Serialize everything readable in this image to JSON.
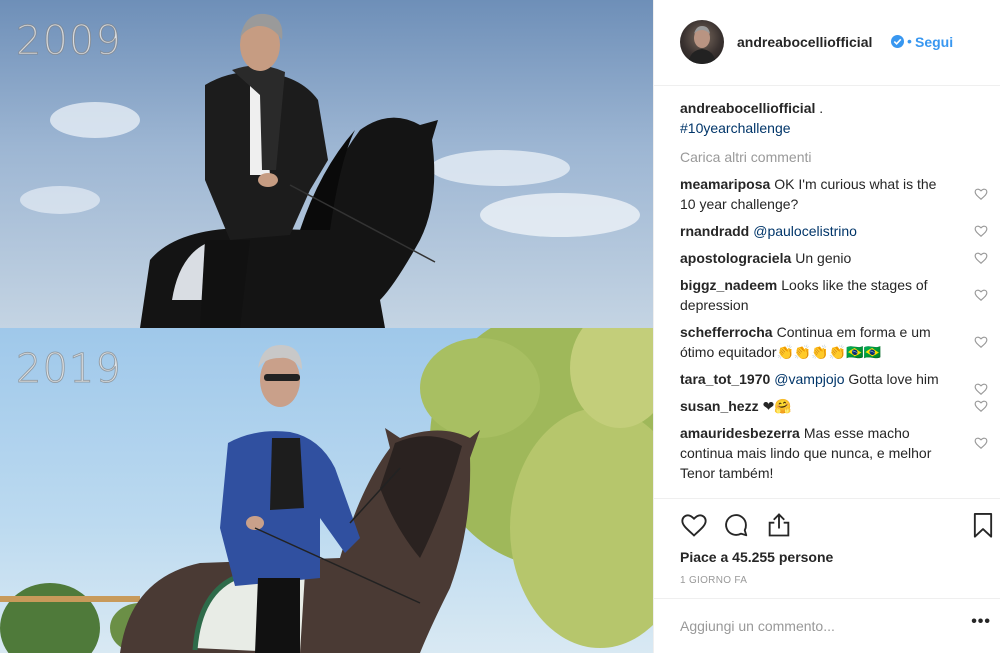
{
  "photo": {
    "top_year": "2009",
    "bottom_year": "2019"
  },
  "header": {
    "username": "andreabocelliofficial",
    "dot": "•",
    "follow_label": "Segui"
  },
  "caption": {
    "username": "andreabocelliofficial",
    "text": ".",
    "hashtag": "#10yearchallenge"
  },
  "load_more_label": "Carica altri commenti",
  "comments": [
    {
      "user": "meamariposa",
      "text": "OK I'm curious what is the 10 year challenge?"
    },
    {
      "user": "rnandradd",
      "mention": "@paulocelistrino",
      "text": ""
    },
    {
      "user": "apostolograciela",
      "text": "Un genio"
    },
    {
      "user": "biggz_nadeem",
      "text": "Looks like the stages of depression"
    },
    {
      "user": "schefferrocha",
      "text": "Continua em forma e um ótimo equitador👏👏👏👏🇧🇷🇧🇷"
    },
    {
      "user": "tara_tot_1970",
      "mention": "@vampjojo",
      "text": "Gotta love him"
    },
    {
      "user": "susan_hezz",
      "text": "❤🤗"
    },
    {
      "user": "amauridesbezerra",
      "text": "Mas esse macho continua mais lindo que nunca, e melhor Tenor também!"
    }
  ],
  "likes_label": "Piace a 45.255 persone",
  "time_label": "1 GIORNO FA",
  "comment_input": {
    "placeholder": "Aggiungi un commento..."
  },
  "more_label": "•••",
  "colors": {
    "accent": "#3897f0",
    "link": "#003569",
    "muted": "#999999",
    "text": "#262626"
  }
}
